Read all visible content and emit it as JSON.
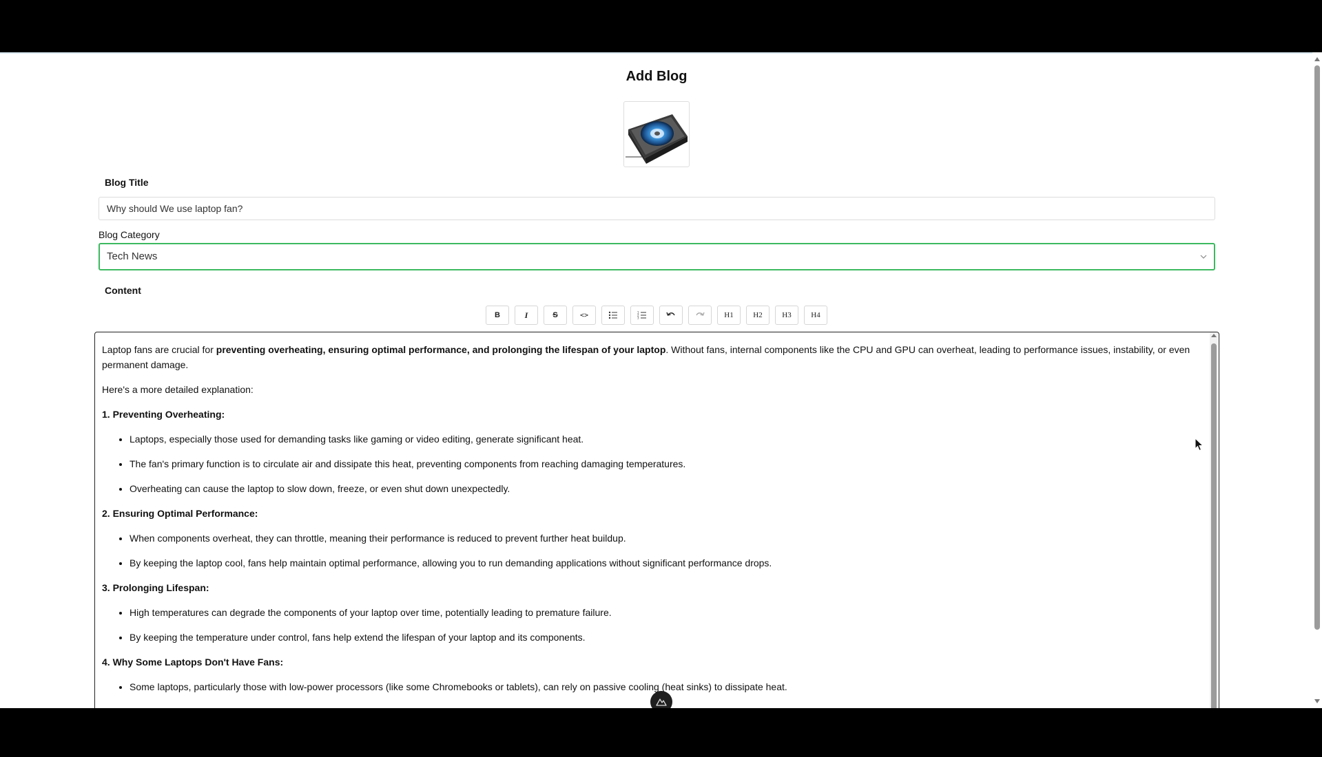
{
  "page": {
    "title": "Add Blog"
  },
  "form": {
    "title_label": "Blog Title",
    "title_value": "Why should We  use laptop fan?",
    "category_label": "Blog Category",
    "category_value": "Tech News",
    "content_label": "Content"
  },
  "toolbar": {
    "bold": "B",
    "italic": "I",
    "strike": "S",
    "code": "<>",
    "bullet_list": "bullet-list-icon",
    "ordered_list": "ordered-list-icon",
    "undo": "undo-icon",
    "redo": "redo-icon",
    "h1": "H1",
    "h2": "H2",
    "h3": "H3",
    "h4": "H4"
  },
  "content": {
    "intro_start": "Laptop fans are crucial for ",
    "intro_bold": "preventing overheating, ensuring optimal performance, and prolonging the lifespan of your laptop",
    "intro_end": ". Without fans, internal components like the CPU and GPU can overheat, leading to performance issues, instability, or even permanent damage.",
    "explanation": "Here's a more detailed explanation:",
    "sections": [
      {
        "heading": "1. Preventing Overheating:",
        "items": [
          "Laptops, especially those used for demanding tasks like gaming or video editing, generate significant heat.",
          "The fan's primary function is to circulate air and dissipate this heat, preventing components from reaching damaging temperatures.",
          "Overheating can cause the laptop to slow down, freeze, or even shut down unexpectedly."
        ]
      },
      {
        "heading": "2. Ensuring Optimal Performance:",
        "items": [
          "When components overheat, they can throttle, meaning their performance is reduced to prevent further heat buildup.",
          "By keeping the laptop cool, fans help maintain optimal performance, allowing you to run demanding applications without significant performance drops."
        ]
      },
      {
        "heading": "3. Prolonging Lifespan:",
        "items": [
          "High temperatures can degrade the components of your laptop over time, potentially leading to premature failure.",
          "By keeping the temperature under control, fans help extend the lifespan of your laptop and its components."
        ]
      },
      {
        "heading": "4. Why Some Laptops Don't Have Fans:",
        "items": [
          "Some laptops, particularly those with low-power processors (like some Chromebooks or tablets), can rely on passive cooling (heat sinks) to dissipate heat."
        ]
      }
    ]
  },
  "colors": {
    "focus_border": "#3cb95f",
    "page_bg": "#ffffff",
    "chrome_bg": "#000000"
  }
}
